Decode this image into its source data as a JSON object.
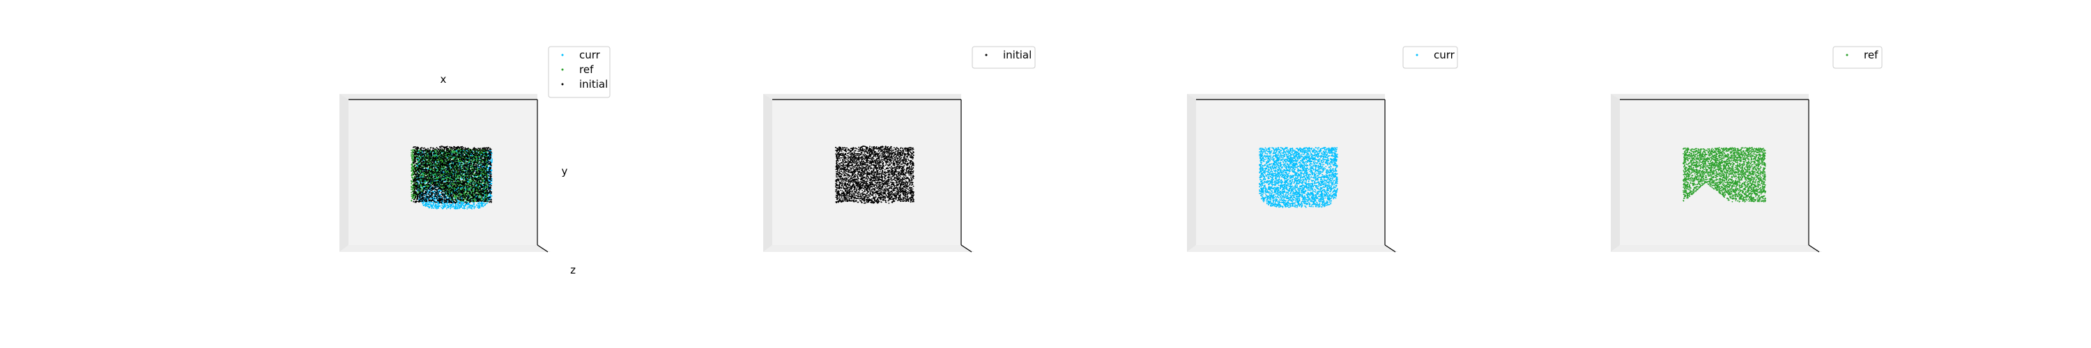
{
  "chart_data": [
    {
      "type": "scatter",
      "subtype": "3d-point-cloud",
      "axis_labels": {
        "x": "x",
        "y": "y",
        "z": "z"
      },
      "legend": {
        "placement": "top-right",
        "entries": [
          {
            "label": "curr",
            "color": "#00bfff"
          },
          {
            "label": "ref",
            "color": "#2ca02c"
          },
          {
            "label": "initial",
            "color": "#000000"
          }
        ]
      },
      "series": [
        {
          "name": "curr",
          "color": "#00bfff",
          "shape": "cup-rounded-bottom"
        },
        {
          "name": "ref",
          "color": "#2ca02c",
          "shape": "notched-bottom"
        },
        {
          "name": "initial",
          "color": "#000000",
          "shape": "rectangle"
        }
      ],
      "overlay": true,
      "grid": false
    },
    {
      "type": "scatter",
      "subtype": "3d-point-cloud",
      "legend": {
        "placement": "top-right",
        "entries": [
          {
            "label": "initial",
            "color": "#000000"
          }
        ]
      },
      "series": [
        {
          "name": "initial",
          "color": "#000000",
          "shape": "rectangle"
        }
      ],
      "grid": false
    },
    {
      "type": "scatter",
      "subtype": "3d-point-cloud",
      "legend": {
        "placement": "top-right",
        "entries": [
          {
            "label": "curr",
            "color": "#00bfff"
          }
        ]
      },
      "series": [
        {
          "name": "curr",
          "color": "#00bfff",
          "shape": "cup-rounded-bottom"
        }
      ],
      "grid": false
    },
    {
      "type": "scatter",
      "subtype": "3d-point-cloud",
      "legend": {
        "placement": "top-right",
        "entries": [
          {
            "label": "ref",
            "color": "#2ca02c"
          }
        ]
      },
      "series": [
        {
          "name": "ref",
          "color": "#2ca02c",
          "shape": "notched-bottom"
        }
      ],
      "grid": false
    }
  ]
}
